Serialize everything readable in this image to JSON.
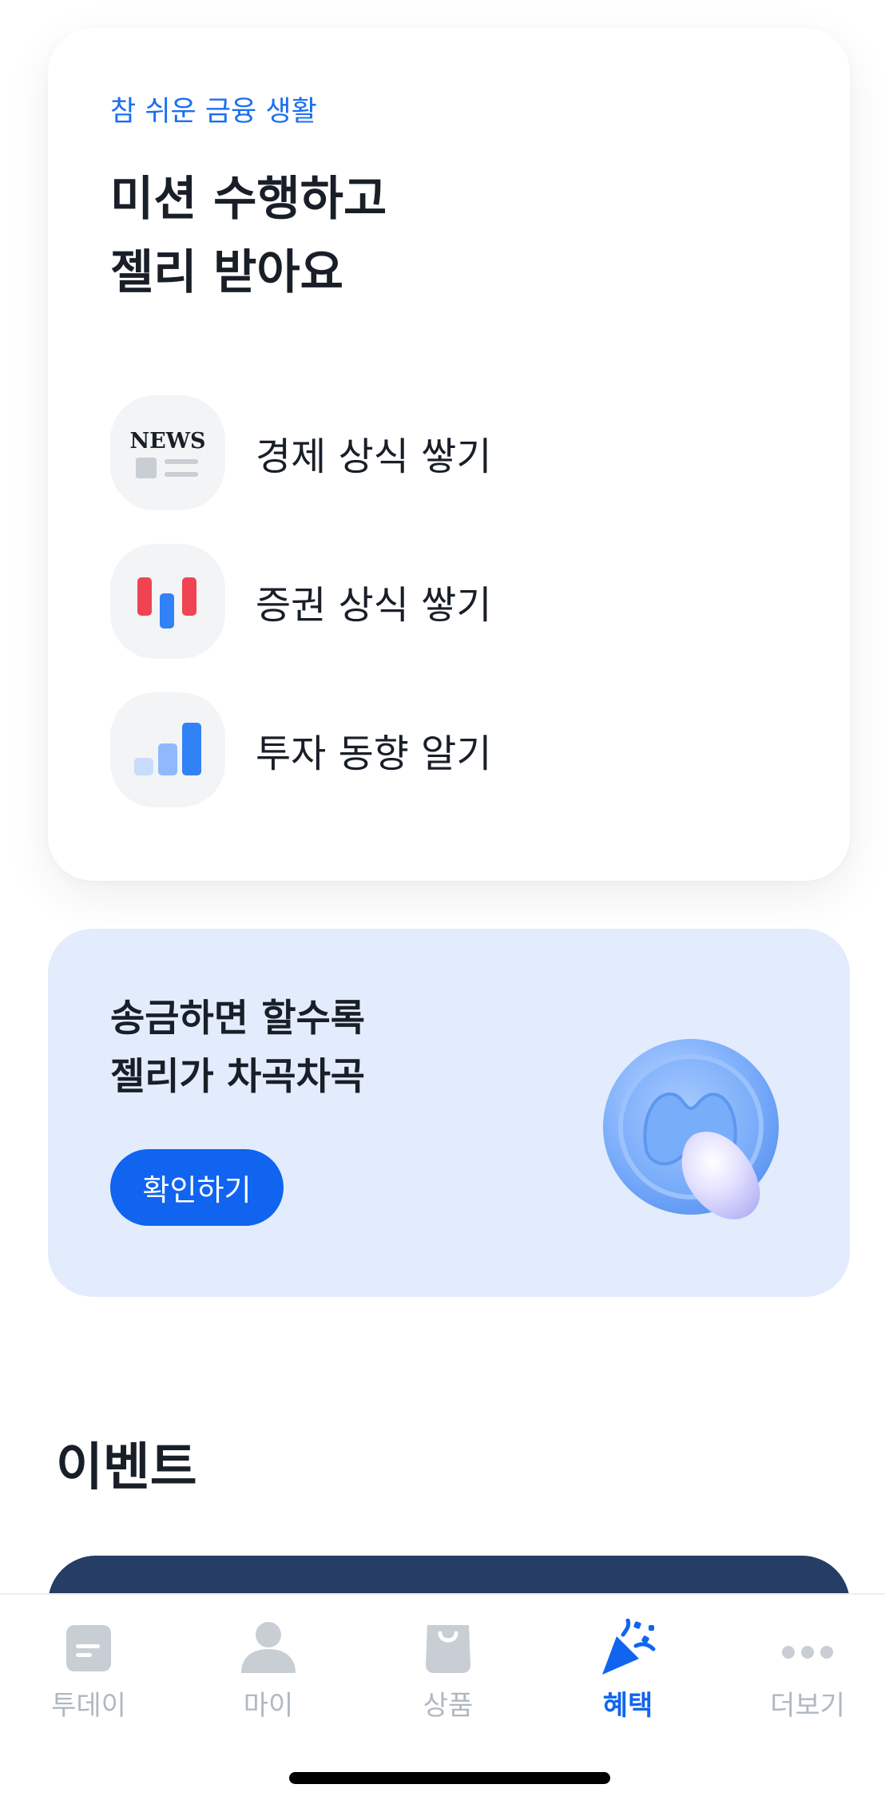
{
  "mission_card": {
    "subtitle": "참 쉬운 금융 생활",
    "title_line1": "미션 수행하고",
    "title_line2": "젤리 받아요",
    "news_icon_text": "NEWS",
    "items": [
      {
        "label": "경제 상식 쌓기",
        "icon": "news-icon"
      },
      {
        "label": "증권 상식 쌓기",
        "icon": "stock-candle-icon"
      },
      {
        "label": "투자 동향 알기",
        "icon": "bar-chart-icon"
      }
    ]
  },
  "remit_banner": {
    "title_line1": "송금하면 할수록",
    "title_line2": "젤리가 차곡차곡",
    "button_label": "확인하기",
    "image": "jelly-coin-illustration"
  },
  "event": {
    "title": "이벤트"
  },
  "tabbar": {
    "tabs": [
      {
        "label": "투데이",
        "icon": "today-icon",
        "active": false
      },
      {
        "label": "마이",
        "icon": "person-icon",
        "active": false
      },
      {
        "label": "상품",
        "icon": "shopping-bag-icon",
        "active": false
      },
      {
        "label": "혜택",
        "icon": "party-popper-icon",
        "active": true
      },
      {
        "label": "더보기",
        "icon": "more-dots-icon",
        "active": false
      }
    ]
  },
  "colors": {
    "accent": "#1064f0",
    "subtitle_blue": "#1b6ff0",
    "banner_bg": "#e3ecfc",
    "event_banner": "#263d66",
    "tab_inactive": "#b0b8c1",
    "icon_bg": "#f2f4f6"
  }
}
